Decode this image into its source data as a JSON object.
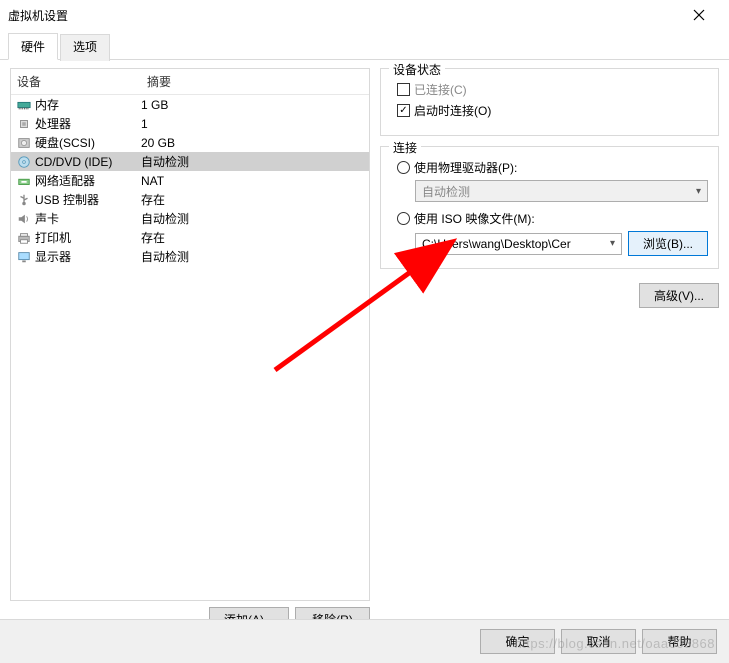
{
  "window": {
    "title": "虚拟机设置"
  },
  "tabs": {
    "hardware": "硬件",
    "options": "选项"
  },
  "listHeader": {
    "device": "设备",
    "summary": "摘要"
  },
  "devices": [
    {
      "icon": "memory",
      "name": "内存",
      "summary": "1 GB"
    },
    {
      "icon": "cpu",
      "name": "处理器",
      "summary": "1"
    },
    {
      "icon": "disk",
      "name": "硬盘(SCSI)",
      "summary": "20 GB"
    },
    {
      "icon": "cd",
      "name": "CD/DVD (IDE)",
      "summary": "自动检测"
    },
    {
      "icon": "net",
      "name": "网络适配器",
      "summary": "NAT"
    },
    {
      "icon": "usb",
      "name": "USB 控制器",
      "summary": "存在"
    },
    {
      "icon": "sound",
      "name": "声卡",
      "summary": "自动检测"
    },
    {
      "icon": "printer",
      "name": "打印机",
      "summary": "存在"
    },
    {
      "icon": "display",
      "name": "显示器",
      "summary": "自动检测"
    }
  ],
  "selectedIndex": 3,
  "leftButtons": {
    "add": "添加(A)...",
    "remove": "移除(R)"
  },
  "deviceStatus": {
    "legend": "设备状态",
    "connected": "已连接(C)",
    "connectedChecked": false,
    "connectAtPowerOn": "启动时连接(O)",
    "connectAtPowerOnChecked": true
  },
  "connection": {
    "legend": "连接",
    "usePhysical": "使用物理驱动器(P):",
    "physicalCombo": "自动检测",
    "useIso": "使用 ISO 映像文件(M):",
    "isoPath": "C:\\Users\\wang\\Desktop\\Cer",
    "browse": "浏览(B)...",
    "selected": "iso"
  },
  "advanced": "高级(V)...",
  "footer": {
    "ok": "确定",
    "cancel": "取消",
    "help": "帮助"
  },
  "watermark": "https://blog.csdn.net/oaa608868"
}
